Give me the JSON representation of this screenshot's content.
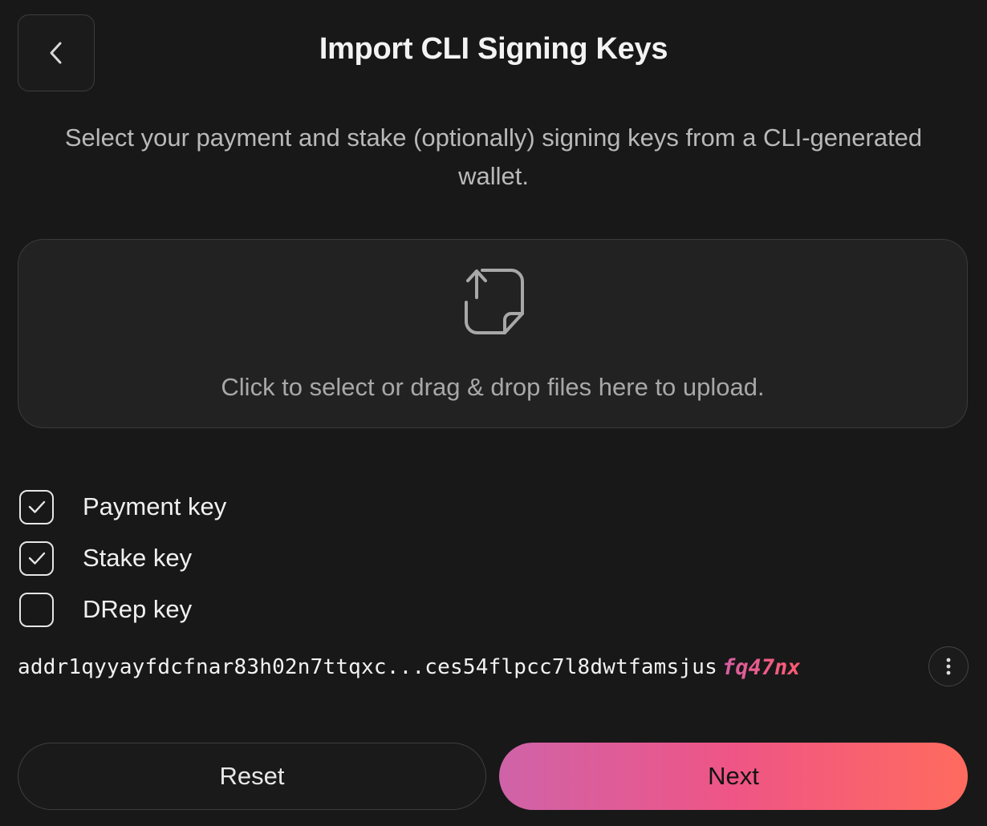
{
  "header": {
    "back_icon": "chevron-left-icon",
    "title": "Import CLI Signing Keys"
  },
  "subtitle": "Select your payment and stake (optionally) signing keys from a CLI-generated wallet.",
  "dropzone": {
    "icon": "upload-file-icon",
    "text": "Click to select or drag & drop files here to upload."
  },
  "keys": [
    {
      "label": "Payment key",
      "checked": true
    },
    {
      "label": "Stake key",
      "checked": true
    },
    {
      "label": "DRep key",
      "checked": false
    }
  ],
  "address": {
    "main": "addr1qyyayfdcfnar83h02n7ttqxc...ces54flpcc7l8dwtfamsjus",
    "tail": "fq47nx",
    "more_icon": "more-vertical-icon"
  },
  "buttons": {
    "reset_label": "Reset",
    "next_label": "Next"
  },
  "colors": {
    "background": "#181818",
    "accent_start": "#cf63a8",
    "accent_end": "#ff6b5e"
  }
}
